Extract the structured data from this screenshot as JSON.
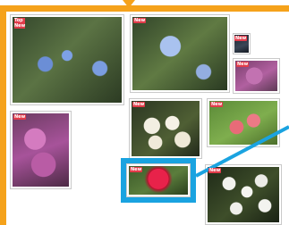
{
  "badges": {
    "new": "New",
    "top": "Top"
  },
  "colors": {
    "frame": "#f5a21b",
    "highlight": "#1aa3e0",
    "badge": "#e23b4a"
  },
  "photos": [
    {
      "subject": "blue forget-me-not flowers",
      "badge": "new"
    },
    {
      "subject": "blue forget-me-not cluster",
      "badge": "new"
    },
    {
      "subject": "dark photo",
      "badge": "new"
    },
    {
      "subject": "pink heather",
      "badge": "new"
    },
    {
      "subject": "pink heather spikes",
      "badge": "new"
    },
    {
      "subject": "white daffodils",
      "badge": "new"
    },
    {
      "subject": "pink lilies",
      "badge": "new"
    },
    {
      "subject": "red carnation",
      "badge": "new",
      "selected": true
    },
    {
      "subject": "white blossoms",
      "badge": "new"
    }
  ]
}
